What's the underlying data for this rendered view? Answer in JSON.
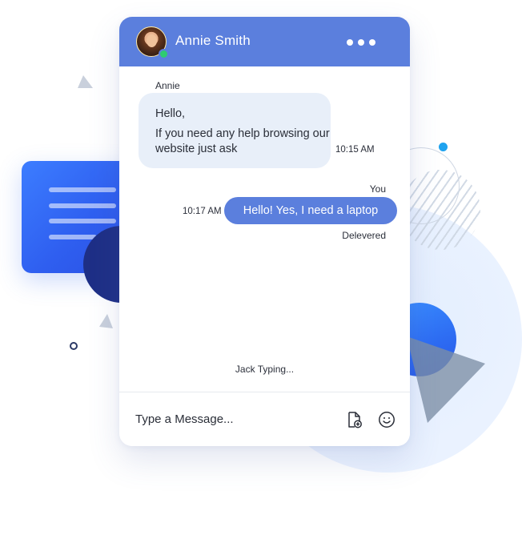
{
  "header": {
    "contact_name": "Annie Smith",
    "avatar_icon": "avatar-photo",
    "status_color": "#2ecc71",
    "more_icon": "more-horizontal-icon",
    "background_color": "#5b7fdd"
  },
  "messages": [
    {
      "sender": "Annie",
      "lines": [
        "Hello,",
        "If you need any help browsing our  website just ask"
      ],
      "time": "10:15 AM",
      "direction": "incoming"
    },
    {
      "sender": "You",
      "text": "Hello! Yes, I need a laptop",
      "time": "10:17 AM",
      "status": "Delevered",
      "direction": "outgoing"
    }
  ],
  "typing_indicator": "Jack Typing...",
  "composer": {
    "placeholder": "Type a Message...",
    "attach_icon": "attach-file-icon",
    "emoji_icon": "emoji-icon"
  },
  "colors": {
    "accent": "#5b7fdd",
    "incoming_bubble": "#e8eff9",
    "deco_blue": "#2f5ff0",
    "deco_navy": "#1e2f86",
    "deco_light": "#eaf2ff"
  }
}
